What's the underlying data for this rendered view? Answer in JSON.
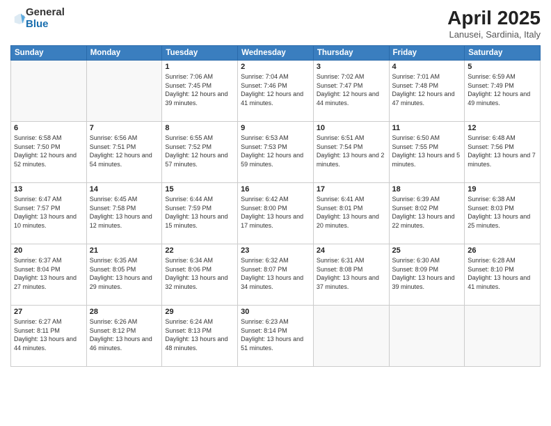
{
  "logo": {
    "general": "General",
    "blue": "Blue"
  },
  "title": {
    "month": "April 2025",
    "location": "Lanusei, Sardinia, Italy"
  },
  "headers": [
    "Sunday",
    "Monday",
    "Tuesday",
    "Wednesday",
    "Thursday",
    "Friday",
    "Saturday"
  ],
  "weeks": [
    [
      {
        "day": "",
        "info": ""
      },
      {
        "day": "",
        "info": ""
      },
      {
        "day": "1",
        "info": "Sunrise: 7:06 AM\nSunset: 7:45 PM\nDaylight: 12 hours and 39 minutes."
      },
      {
        "day": "2",
        "info": "Sunrise: 7:04 AM\nSunset: 7:46 PM\nDaylight: 12 hours and 41 minutes."
      },
      {
        "day": "3",
        "info": "Sunrise: 7:02 AM\nSunset: 7:47 PM\nDaylight: 12 hours and 44 minutes."
      },
      {
        "day": "4",
        "info": "Sunrise: 7:01 AM\nSunset: 7:48 PM\nDaylight: 12 hours and 47 minutes."
      },
      {
        "day": "5",
        "info": "Sunrise: 6:59 AM\nSunset: 7:49 PM\nDaylight: 12 hours and 49 minutes."
      }
    ],
    [
      {
        "day": "6",
        "info": "Sunrise: 6:58 AM\nSunset: 7:50 PM\nDaylight: 12 hours and 52 minutes."
      },
      {
        "day": "7",
        "info": "Sunrise: 6:56 AM\nSunset: 7:51 PM\nDaylight: 12 hours and 54 minutes."
      },
      {
        "day": "8",
        "info": "Sunrise: 6:55 AM\nSunset: 7:52 PM\nDaylight: 12 hours and 57 minutes."
      },
      {
        "day": "9",
        "info": "Sunrise: 6:53 AM\nSunset: 7:53 PM\nDaylight: 12 hours and 59 minutes."
      },
      {
        "day": "10",
        "info": "Sunrise: 6:51 AM\nSunset: 7:54 PM\nDaylight: 13 hours and 2 minutes."
      },
      {
        "day": "11",
        "info": "Sunrise: 6:50 AM\nSunset: 7:55 PM\nDaylight: 13 hours and 5 minutes."
      },
      {
        "day": "12",
        "info": "Sunrise: 6:48 AM\nSunset: 7:56 PM\nDaylight: 13 hours and 7 minutes."
      }
    ],
    [
      {
        "day": "13",
        "info": "Sunrise: 6:47 AM\nSunset: 7:57 PM\nDaylight: 13 hours and 10 minutes."
      },
      {
        "day": "14",
        "info": "Sunrise: 6:45 AM\nSunset: 7:58 PM\nDaylight: 13 hours and 12 minutes."
      },
      {
        "day": "15",
        "info": "Sunrise: 6:44 AM\nSunset: 7:59 PM\nDaylight: 13 hours and 15 minutes."
      },
      {
        "day": "16",
        "info": "Sunrise: 6:42 AM\nSunset: 8:00 PM\nDaylight: 13 hours and 17 minutes."
      },
      {
        "day": "17",
        "info": "Sunrise: 6:41 AM\nSunset: 8:01 PM\nDaylight: 13 hours and 20 minutes."
      },
      {
        "day": "18",
        "info": "Sunrise: 6:39 AM\nSunset: 8:02 PM\nDaylight: 13 hours and 22 minutes."
      },
      {
        "day": "19",
        "info": "Sunrise: 6:38 AM\nSunset: 8:03 PM\nDaylight: 13 hours and 25 minutes."
      }
    ],
    [
      {
        "day": "20",
        "info": "Sunrise: 6:37 AM\nSunset: 8:04 PM\nDaylight: 13 hours and 27 minutes."
      },
      {
        "day": "21",
        "info": "Sunrise: 6:35 AM\nSunset: 8:05 PM\nDaylight: 13 hours and 29 minutes."
      },
      {
        "day": "22",
        "info": "Sunrise: 6:34 AM\nSunset: 8:06 PM\nDaylight: 13 hours and 32 minutes."
      },
      {
        "day": "23",
        "info": "Sunrise: 6:32 AM\nSunset: 8:07 PM\nDaylight: 13 hours and 34 minutes."
      },
      {
        "day": "24",
        "info": "Sunrise: 6:31 AM\nSunset: 8:08 PM\nDaylight: 13 hours and 37 minutes."
      },
      {
        "day": "25",
        "info": "Sunrise: 6:30 AM\nSunset: 8:09 PM\nDaylight: 13 hours and 39 minutes."
      },
      {
        "day": "26",
        "info": "Sunrise: 6:28 AM\nSunset: 8:10 PM\nDaylight: 13 hours and 41 minutes."
      }
    ],
    [
      {
        "day": "27",
        "info": "Sunrise: 6:27 AM\nSunset: 8:11 PM\nDaylight: 13 hours and 44 minutes."
      },
      {
        "day": "28",
        "info": "Sunrise: 6:26 AM\nSunset: 8:12 PM\nDaylight: 13 hours and 46 minutes."
      },
      {
        "day": "29",
        "info": "Sunrise: 6:24 AM\nSunset: 8:13 PM\nDaylight: 13 hours and 48 minutes."
      },
      {
        "day": "30",
        "info": "Sunrise: 6:23 AM\nSunset: 8:14 PM\nDaylight: 13 hours and 51 minutes."
      },
      {
        "day": "",
        "info": ""
      },
      {
        "day": "",
        "info": ""
      },
      {
        "day": "",
        "info": ""
      }
    ]
  ]
}
